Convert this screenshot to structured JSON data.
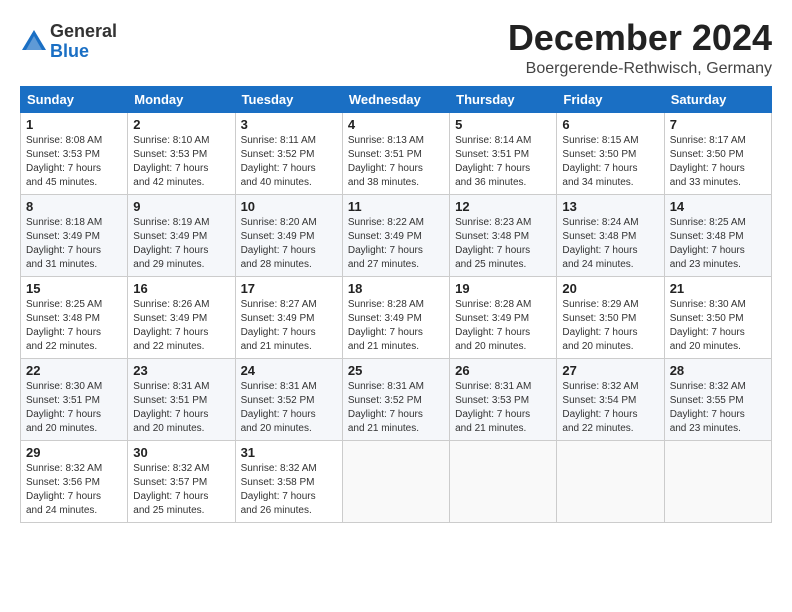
{
  "logo": {
    "general": "General",
    "blue": "Blue"
  },
  "header": {
    "month": "December 2024",
    "location": "Boergerende-Rethwisch, Germany"
  },
  "weekdays": [
    "Sunday",
    "Monday",
    "Tuesday",
    "Wednesday",
    "Thursday",
    "Friday",
    "Saturday"
  ],
  "weeks": [
    [
      {
        "day": "1",
        "lines": [
          "Sunrise: 8:08 AM",
          "Sunset: 3:53 PM",
          "Daylight: 7 hours",
          "and 45 minutes."
        ]
      },
      {
        "day": "2",
        "lines": [
          "Sunrise: 8:10 AM",
          "Sunset: 3:53 PM",
          "Daylight: 7 hours",
          "and 42 minutes."
        ]
      },
      {
        "day": "3",
        "lines": [
          "Sunrise: 8:11 AM",
          "Sunset: 3:52 PM",
          "Daylight: 7 hours",
          "and 40 minutes."
        ]
      },
      {
        "day": "4",
        "lines": [
          "Sunrise: 8:13 AM",
          "Sunset: 3:51 PM",
          "Daylight: 7 hours",
          "and 38 minutes."
        ]
      },
      {
        "day": "5",
        "lines": [
          "Sunrise: 8:14 AM",
          "Sunset: 3:51 PM",
          "Daylight: 7 hours",
          "and 36 minutes."
        ]
      },
      {
        "day": "6",
        "lines": [
          "Sunrise: 8:15 AM",
          "Sunset: 3:50 PM",
          "Daylight: 7 hours",
          "and 34 minutes."
        ]
      },
      {
        "day": "7",
        "lines": [
          "Sunrise: 8:17 AM",
          "Sunset: 3:50 PM",
          "Daylight: 7 hours",
          "and 33 minutes."
        ]
      }
    ],
    [
      {
        "day": "8",
        "lines": [
          "Sunrise: 8:18 AM",
          "Sunset: 3:49 PM",
          "Daylight: 7 hours",
          "and 31 minutes."
        ]
      },
      {
        "day": "9",
        "lines": [
          "Sunrise: 8:19 AM",
          "Sunset: 3:49 PM",
          "Daylight: 7 hours",
          "and 29 minutes."
        ]
      },
      {
        "day": "10",
        "lines": [
          "Sunrise: 8:20 AM",
          "Sunset: 3:49 PM",
          "Daylight: 7 hours",
          "and 28 minutes."
        ]
      },
      {
        "day": "11",
        "lines": [
          "Sunrise: 8:22 AM",
          "Sunset: 3:49 PM",
          "Daylight: 7 hours",
          "and 27 minutes."
        ]
      },
      {
        "day": "12",
        "lines": [
          "Sunrise: 8:23 AM",
          "Sunset: 3:48 PM",
          "Daylight: 7 hours",
          "and 25 minutes."
        ]
      },
      {
        "day": "13",
        "lines": [
          "Sunrise: 8:24 AM",
          "Sunset: 3:48 PM",
          "Daylight: 7 hours",
          "and 24 minutes."
        ]
      },
      {
        "day": "14",
        "lines": [
          "Sunrise: 8:25 AM",
          "Sunset: 3:48 PM",
          "Daylight: 7 hours",
          "and 23 minutes."
        ]
      }
    ],
    [
      {
        "day": "15",
        "lines": [
          "Sunrise: 8:25 AM",
          "Sunset: 3:48 PM",
          "Daylight: 7 hours",
          "and 22 minutes."
        ]
      },
      {
        "day": "16",
        "lines": [
          "Sunrise: 8:26 AM",
          "Sunset: 3:49 PM",
          "Daylight: 7 hours",
          "and 22 minutes."
        ]
      },
      {
        "day": "17",
        "lines": [
          "Sunrise: 8:27 AM",
          "Sunset: 3:49 PM",
          "Daylight: 7 hours",
          "and 21 minutes."
        ]
      },
      {
        "day": "18",
        "lines": [
          "Sunrise: 8:28 AM",
          "Sunset: 3:49 PM",
          "Daylight: 7 hours",
          "and 21 minutes."
        ]
      },
      {
        "day": "19",
        "lines": [
          "Sunrise: 8:28 AM",
          "Sunset: 3:49 PM",
          "Daylight: 7 hours",
          "and 20 minutes."
        ]
      },
      {
        "day": "20",
        "lines": [
          "Sunrise: 8:29 AM",
          "Sunset: 3:50 PM",
          "Daylight: 7 hours",
          "and 20 minutes."
        ]
      },
      {
        "day": "21",
        "lines": [
          "Sunrise: 8:30 AM",
          "Sunset: 3:50 PM",
          "Daylight: 7 hours",
          "and 20 minutes."
        ]
      }
    ],
    [
      {
        "day": "22",
        "lines": [
          "Sunrise: 8:30 AM",
          "Sunset: 3:51 PM",
          "Daylight: 7 hours",
          "and 20 minutes."
        ]
      },
      {
        "day": "23",
        "lines": [
          "Sunrise: 8:31 AM",
          "Sunset: 3:51 PM",
          "Daylight: 7 hours",
          "and 20 minutes."
        ]
      },
      {
        "day": "24",
        "lines": [
          "Sunrise: 8:31 AM",
          "Sunset: 3:52 PM",
          "Daylight: 7 hours",
          "and 20 minutes."
        ]
      },
      {
        "day": "25",
        "lines": [
          "Sunrise: 8:31 AM",
          "Sunset: 3:52 PM",
          "Daylight: 7 hours",
          "and 21 minutes."
        ]
      },
      {
        "day": "26",
        "lines": [
          "Sunrise: 8:31 AM",
          "Sunset: 3:53 PM",
          "Daylight: 7 hours",
          "and 21 minutes."
        ]
      },
      {
        "day": "27",
        "lines": [
          "Sunrise: 8:32 AM",
          "Sunset: 3:54 PM",
          "Daylight: 7 hours",
          "and 22 minutes."
        ]
      },
      {
        "day": "28",
        "lines": [
          "Sunrise: 8:32 AM",
          "Sunset: 3:55 PM",
          "Daylight: 7 hours",
          "and 23 minutes."
        ]
      }
    ],
    [
      {
        "day": "29",
        "lines": [
          "Sunrise: 8:32 AM",
          "Sunset: 3:56 PM",
          "Daylight: 7 hours",
          "and 24 minutes."
        ]
      },
      {
        "day": "30",
        "lines": [
          "Sunrise: 8:32 AM",
          "Sunset: 3:57 PM",
          "Daylight: 7 hours",
          "and 25 minutes."
        ]
      },
      {
        "day": "31",
        "lines": [
          "Sunrise: 8:32 AM",
          "Sunset: 3:58 PM",
          "Daylight: 7 hours",
          "and 26 minutes."
        ]
      },
      null,
      null,
      null,
      null
    ]
  ]
}
